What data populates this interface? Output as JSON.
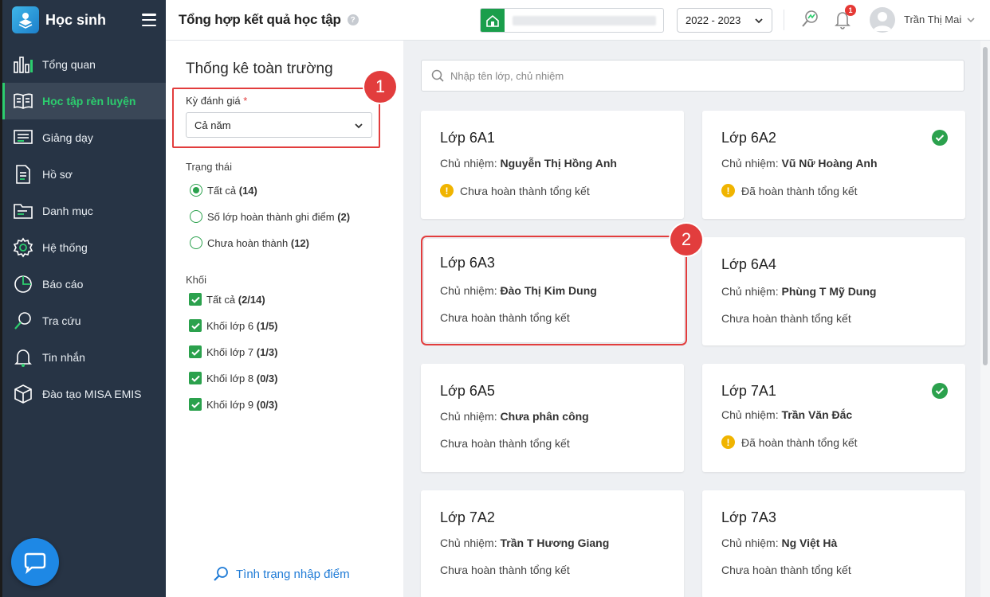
{
  "app": {
    "brand": "Học sinh"
  },
  "sidebar": {
    "items": [
      {
        "label": "Tổng quan",
        "icon": "bar-chart-icon"
      },
      {
        "label": "Học tập rèn luyện",
        "icon": "book-icon",
        "active": true
      },
      {
        "label": "Giảng dạy",
        "icon": "board-icon"
      },
      {
        "label": "Hồ sơ",
        "icon": "document-icon"
      },
      {
        "label": "Danh mục",
        "icon": "folder-icon"
      },
      {
        "label": "Hệ thống",
        "icon": "gear-icon"
      },
      {
        "label": "Báo cáo",
        "icon": "pie-chart-icon"
      },
      {
        "label": "Tra cứu",
        "icon": "search-icon"
      },
      {
        "label": "Tin nhắn",
        "icon": "bell-icon"
      },
      {
        "label": "Đào tạo MISA EMIS",
        "icon": "cube-icon"
      }
    ]
  },
  "header": {
    "title": "Tổng hợp kết quả học tập",
    "help": "?",
    "year": "2022 - 2023",
    "notification_count": "1",
    "user_name": "Trần Thị Mai"
  },
  "filter": {
    "title": "Thống kê toàn trường",
    "term_label": "Kỳ đánh giá",
    "term_required": "*",
    "term_value": "Cả năm",
    "status_label": "Trạng thái",
    "status_options": [
      {
        "text": "Tất cả",
        "count": "(14)",
        "selected": true
      },
      {
        "text": "Số lớp hoàn thành ghi điểm",
        "count": "(2)",
        "selected": false
      },
      {
        "text": "Chưa hoàn thành",
        "count": "(12)",
        "selected": false
      }
    ],
    "grade_label": "Khối",
    "grade_options": [
      {
        "text": "Tất cả",
        "count": "(2/14)",
        "checked": true
      },
      {
        "text": "Khối lớp 6",
        "count": "(1/5)",
        "checked": true
      },
      {
        "text": "Khối lớp 7",
        "count": "(1/3)",
        "checked": true
      },
      {
        "text": "Khối lớp 8",
        "count": "(0/3)",
        "checked": true
      },
      {
        "text": "Khối lớp 9",
        "count": "(0/3)",
        "checked": true
      }
    ],
    "status_link": "Tình trạng nhập điểm"
  },
  "markers": {
    "m1": "1",
    "m2": "2"
  },
  "main": {
    "search_placeholder": "Nhập tên lớp, chủ nhiệm",
    "teacher_prefix": "Chủ nhiệm:",
    "classes": [
      {
        "name": "Lớp 6A1",
        "teacher": "Nguyễn Thị Hồng Anh",
        "status": "Chưa hoàn thành tổng kết",
        "warn": true,
        "done": false
      },
      {
        "name": "Lớp 6A2",
        "teacher": "Vũ Nữ Hoàng Anh",
        "status": "Đã hoàn thành tổng kết",
        "warn": true,
        "done": true
      },
      {
        "name": "Lớp 6A3",
        "teacher": "Đào Thị Kim Dung",
        "status": "Chưa hoàn thành tổng kết",
        "warn": false,
        "done": false
      },
      {
        "name": "Lớp 6A4",
        "teacher": "Phùng T Mỹ Dung",
        "status": "Chưa hoàn thành tổng kết",
        "warn": false,
        "done": false
      },
      {
        "name": "Lớp 6A5",
        "teacher": "Chưa phân công",
        "status": "Chưa hoàn thành tổng kết",
        "warn": false,
        "done": false
      },
      {
        "name": "Lớp 7A1",
        "teacher": "Trần Văn Đắc",
        "status": "Đã hoàn thành tổng kết",
        "warn": true,
        "done": true
      },
      {
        "name": "Lớp 7A2",
        "teacher": "Trần T Hương Giang",
        "status": "Chưa hoàn thành tổng kết",
        "warn": false,
        "done": false
      },
      {
        "name": "Lớp 7A3",
        "teacher": "Ng Việt Hà",
        "status": "Chưa hoàn thành tổng kết",
        "warn": false,
        "done": false
      }
    ]
  },
  "colors": {
    "accent": "#2ccd6e",
    "sidebar": "#273445",
    "highlight": "#e23d3d",
    "link": "#1f7bd6"
  }
}
